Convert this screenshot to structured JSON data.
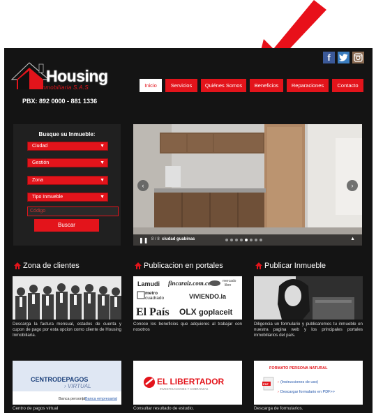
{
  "header": {
    "brand": "Housing",
    "brand_sub": "Inmobiliaria S.A.S",
    "pbx": "PBX: 892 0000 - 881 1336"
  },
  "social": {
    "facebook": "f",
    "twitter": "t",
    "instagram": "◙"
  },
  "nav": {
    "items": [
      {
        "label": "Inicio"
      },
      {
        "label": "Servicios"
      },
      {
        "label": "Quiénes Somos"
      },
      {
        "label": "Beneficios"
      },
      {
        "label": "Reparaciones"
      },
      {
        "label": "Contacto"
      }
    ],
    "active": "Inicio"
  },
  "search": {
    "title": "Busque su Inmueble:",
    "selects": [
      "Ciudad",
      "Gestión",
      "Zona",
      "Tipo Inmueble"
    ],
    "code_placeholder": "Código",
    "submit_label": "Buscar"
  },
  "slider": {
    "counter": "8 / 8",
    "caption": "ciudad guabinas",
    "dots_total": 8,
    "dot_active": 5
  },
  "sections": [
    {
      "title": "Zona de clientes",
      "text": "Descarga la factura mensual, estados de cuenta y cupon de pago por esta opcion como cliente de Housing Inmobiliaria."
    },
    {
      "title": "Publicacion en portales",
      "text": "Conoce los beneficios que adquieres al trabajar con nosotros",
      "logos": [
        "Lamudi",
        "fincaraiz.com.co",
        "mercado libre",
        "metro cuadrado",
        "VIVIENDO.la",
        "El País",
        "OLX",
        "goplaceit"
      ]
    },
    {
      "title": "Publicar Inmueble",
      "text": "Diligencia un formulario y publicaremos tu inmueble en nuestra pagina web y los principales portales inmobiliarios del país."
    }
  ],
  "bottom_cards": [
    {
      "brand": "CENTRODEPAGOS",
      "brand_sub": "VIRTUAL",
      "link_personal": "Banca personal",
      "link_empresarial": "Banca empresarial",
      "caption": "Centro de pagos virtual"
    },
    {
      "brand": "EL LIBERTADOR",
      "brand_sub": "INVESTIGACIONES Y COBRANZAS",
      "caption": "Consultar resultado de estudio."
    },
    {
      "title": "FORMATO PERSONA NATURAL",
      "link_instructions": "(Instrucciones de uso)",
      "link_download": "Descargar formulario en PDF>>",
      "caption": "Descarga de formularios."
    }
  ],
  "colors": {
    "accent": "#e3141b",
    "background": "#141414",
    "annotation": "#e8101a"
  }
}
